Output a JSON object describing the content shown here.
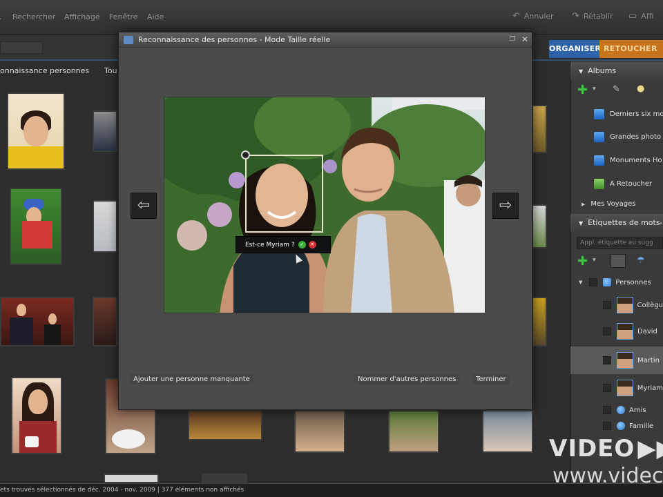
{
  "menu": {
    "items": [
      "...",
      "Rechercher",
      "Affichage",
      "Fenêtre",
      "Aide"
    ],
    "undo": "Annuler",
    "redo": "Rétablir",
    "display": "Affi"
  },
  "tabs": {
    "organize": "ORGANISER",
    "retouch": "RETOUCHER"
  },
  "gallery": {
    "header": "onnaissance personnes",
    "header2": "Tou"
  },
  "dialog": {
    "title": "Reconnaissance des personnes - Mode Taille réelle",
    "face_prompt": "Est-ce Myriam ?",
    "add_missing": "Ajouter une personne manquante",
    "name_others": "Nommer d'autres personnes",
    "finish": "Terminer"
  },
  "right_panel": {
    "albums_header": "Albums",
    "albums": [
      {
        "label": "Derniers six mo",
        "icon": "album-icon"
      },
      {
        "label": "Grandes photo",
        "icon": "album-icon"
      },
      {
        "label": "Monuments Ho",
        "icon": "album-icon"
      },
      {
        "label": "A Retoucher",
        "icon": "smart-album-icon"
      }
    ],
    "voyages": "Mes Voyages",
    "tags_header": "Etiquettes de mots-",
    "tag_search_placeholder": "Appl. étiquette au sugg",
    "people_category": "Personnes",
    "people": [
      {
        "label": "Collègu"
      },
      {
        "label": "David"
      },
      {
        "label": "Martin"
      },
      {
        "label": "Myriam"
      }
    ],
    "categories": [
      "Amis",
      "Famille"
    ]
  },
  "status": {
    "text": "ets trouvés sélectionnés  de déc. 2004 - nov. 2009  |  377 éléments non affichés"
  },
  "watermark": {
    "line1": "VIDEO",
    "line2": "www.videc"
  },
  "colors": {
    "accent_blue": "#2e63a9",
    "accent_orange": "#c8731d"
  }
}
